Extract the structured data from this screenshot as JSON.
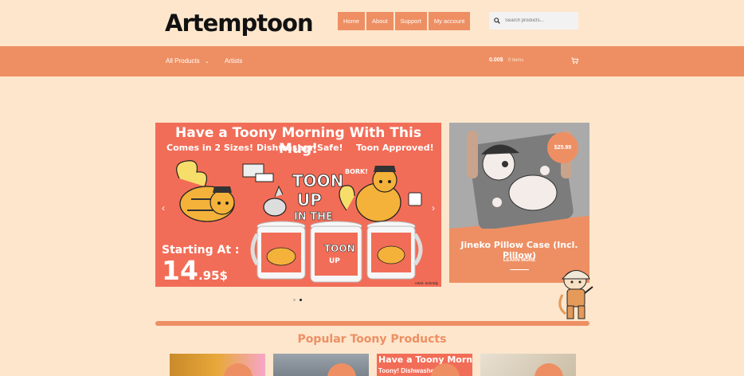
{
  "header": {
    "logo": "Artemptoon",
    "nav": [
      "Home",
      "About",
      "Support",
      "My account"
    ],
    "search_placeholder": "Search products..."
  },
  "navbar": {
    "all_products": "All Products",
    "artists": "Artists",
    "cart_total": "0.00$",
    "cart_items": "0 items"
  },
  "slider": {
    "title": "Have a Toony Morning With This Mug!",
    "features": [
      "Comes in 2 Sizes!",
      "Dishwasher Safe!",
      "Toon Approved!"
    ],
    "starting_label": "Starting At :",
    "price_main": "14",
    "price_cents": ".95$",
    "artist_credit": "Artist: Schrödy",
    "mug_text": "TOON UP IN THE MORNING",
    "bork": "BORK!",
    "dots_active": 1
  },
  "promo": {
    "price": "$25.99",
    "title": "Jineko Pillow Case (Incl. Pillow)",
    "learn_more": "LEARN MORE"
  },
  "section": {
    "popular_title": "Popular Toony Products"
  },
  "products": [
    {
      "text": "",
      "text2": ""
    },
    {
      "text": "",
      "text2": ""
    },
    {
      "text": "Have a Toony Morning With Th",
      "text2": "Toony!   Dishwasher"
    },
    {
      "text": "",
      "text2": ""
    }
  ],
  "colors": {
    "accent": "#ee8f63",
    "background": "#fde6cc",
    "slider_bg": "#f26d57"
  }
}
